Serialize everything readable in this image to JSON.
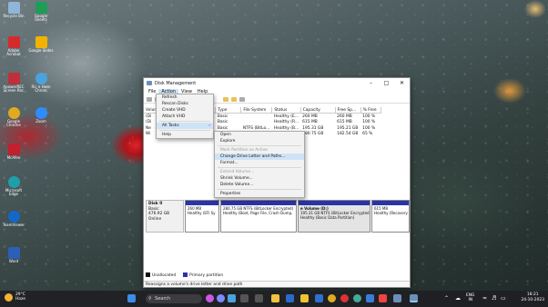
{
  "desktop": {
    "icons": [
      {
        "label": "Recycle Bin",
        "icon": "recycle-bin-icon",
        "color": "#8fb6d9"
      },
      {
        "label": "Google Sheets",
        "icon": "sheets-icon",
        "color": "#1e9d58"
      },
      {
        "label": "Adobe Acrobat",
        "icon": "acrobat-icon",
        "color": "#d32b2b"
      },
      {
        "label": "Google Slides",
        "icon": "slides-icon",
        "color": "#f2b300"
      },
      {
        "label": "ApowerREC Screen Rec",
        "icon": "screen-recorder-icon",
        "color": "#c0303a"
      },
      {
        "label": "Ric e Hwin Chrom",
        "icon": "chrome-icon",
        "color": "#4aa3df"
      },
      {
        "label": "Google Chrome",
        "icon": "chrome-icon",
        "color": "#e0aa20"
      },
      {
        "label": "Zoom",
        "icon": "zoom-icon",
        "color": "#2d8cff"
      },
      {
        "label": "McAfee",
        "icon": "mcafee-icon",
        "color": "#c21f2f"
      },
      {
        "label": "Microsoft Edge",
        "icon": "edge-icon",
        "color": "#1ea0a8"
      },
      {
        "label": "TeamViewer",
        "icon": "teamviewer-icon",
        "color": "#1168c9"
      },
      {
        "label": "Word",
        "icon": "word-icon",
        "color": "#2b5fb8"
      }
    ]
  },
  "window": {
    "title": "Disk Management",
    "menu": [
      "File",
      "Action",
      "View",
      "Help"
    ],
    "columns": [
      "Volume",
      "Layout",
      "Type",
      "File System",
      "Status",
      "Capacity",
      "Free Sp...",
      "% Free"
    ],
    "rows": [
      {
        "volume": "(Di",
        "type": "Basic",
        "status": "Healthy (E...",
        "capacity": "260 MB",
        "free": "260 MB",
        "pct": "100 %"
      },
      {
        "volume": "(Di",
        "type": "Basic",
        "status": "Healthy (R...",
        "capacity": "615 MB",
        "free": "615 MB",
        "pct": "100 %"
      },
      {
        "volume": "Ne",
        "type": "Basic",
        "fs": "NTFS (BitLo...",
        "status": "Healthy (B...",
        "capacity": "195.31 GB",
        "free": "195.21 GB",
        "pct": "100 %"
      },
      {
        "volume": "Wi",
        "type": "Basic",
        "status": "Healthy (B...",
        "capacity": "280.75 GB",
        "free": "182.54 GB",
        "pct": "65 %"
      }
    ],
    "action_menu": [
      "Refresh",
      "Rescan Disks",
      "Create VHD",
      "Attach VHD",
      "All Tasks",
      "Help"
    ],
    "submenu": [
      {
        "label": "Open",
        "state": "normal"
      },
      {
        "label": "Explore",
        "state": "normal"
      },
      {
        "label": "Mark Partition as Active",
        "state": "disabled"
      },
      {
        "label": "Change Drive Letter and Paths...",
        "state": "highlight"
      },
      {
        "label": "Format...",
        "state": "normal"
      },
      {
        "label": "Extend Volume...",
        "state": "disabled"
      },
      {
        "label": "Shrink Volume...",
        "state": "normal"
      },
      {
        "label": "Delete Volume...",
        "state": "normal"
      },
      {
        "label": "Properties",
        "state": "normal"
      }
    ],
    "disk": {
      "name": "Disk 0",
      "type": "Basic",
      "size": "476.92 GB",
      "status": "Online"
    },
    "partitions": [
      {
        "l1": "260 MB",
        "l2": "Healthy (EFI Sy"
      },
      {
        "l1": "280.75 GB NTFS (BitLocker Encrypted)",
        "l2": "Healthy (Boot, Page File, Crash Dump,"
      },
      {
        "l0": "e Volume (D:)",
        "l1": "195.31 GB NTFS (BitLocker Encrypted)",
        "l2": "Healthy (Basic Data Partition)"
      },
      {
        "l1": "615 MB",
        "l2": "Healthy (Recovery"
      }
    ],
    "legend": [
      {
        "label": "Unallocated",
        "color": "#111111"
      },
      {
        "label": "Primary partition",
        "color": "#2b34a7"
      }
    ],
    "status_text": "Reassigns a volume's drive letter and drive path"
  },
  "taskbar": {
    "temp": "29°C",
    "weather": "Haze",
    "search": "Search",
    "lang1": "ENG",
    "lang2": "IN",
    "time": "18:21",
    "date": "24-10-2023"
  }
}
